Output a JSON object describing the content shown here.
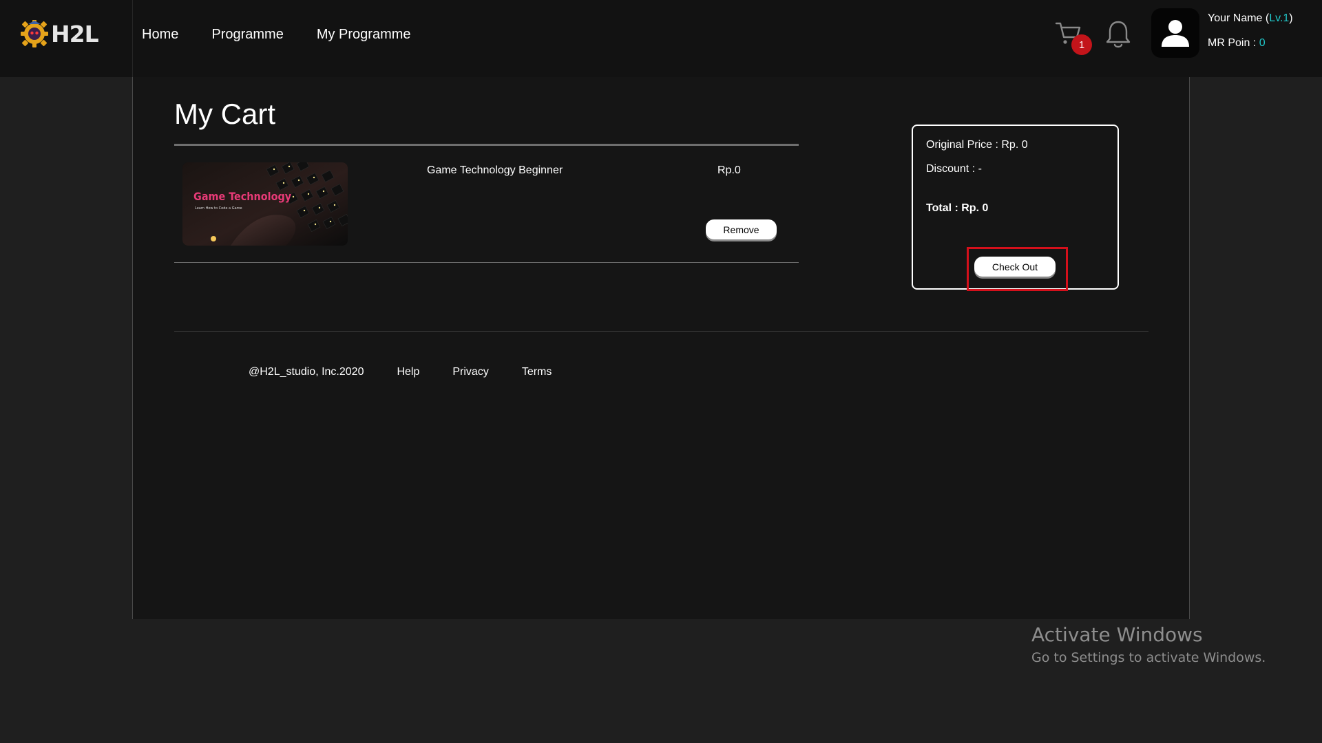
{
  "header": {
    "logo_text": "H2L",
    "nav": [
      "Home",
      "Programme",
      "My Programme"
    ],
    "cart_count": "1",
    "user": {
      "name_prefix": "Your Name (",
      "level": "Lv.1",
      "name_suffix": ")",
      "points_label": "MR Poin : ",
      "points_value": "0"
    },
    "icons": [
      "gear-logo-icon",
      "cart-icon",
      "bell-icon",
      "user-icon"
    ]
  },
  "page": {
    "title": "My Cart"
  },
  "cart": {
    "items": [
      {
        "name": "Game Technology Beginner",
        "price": "Rp.0",
        "thumb_title": "Game Technology",
        "thumb_subtitle": "Learn How to Code a Game",
        "remove_label": "Remove"
      }
    ]
  },
  "summary": {
    "original_price": "Original Price : Rp. 0",
    "discount": "Discount : -",
    "total": "Total : Rp. 0",
    "checkout_label": "Check Out"
  },
  "footer": {
    "copyright": "@H2L_studio, Inc.2020",
    "links": [
      "Help",
      "Privacy",
      "Terms"
    ]
  },
  "watermark": {
    "title": "Activate Windows",
    "subtitle": "Go to Settings to activate Windows."
  },
  "colors": {
    "background": "#1f1f1f",
    "header": "#121212",
    "panel": "#151515",
    "accent": "#20c6c8",
    "badge": "#c3141a",
    "highlight": "#d4101b",
    "thumb_title": "#e83a77"
  }
}
